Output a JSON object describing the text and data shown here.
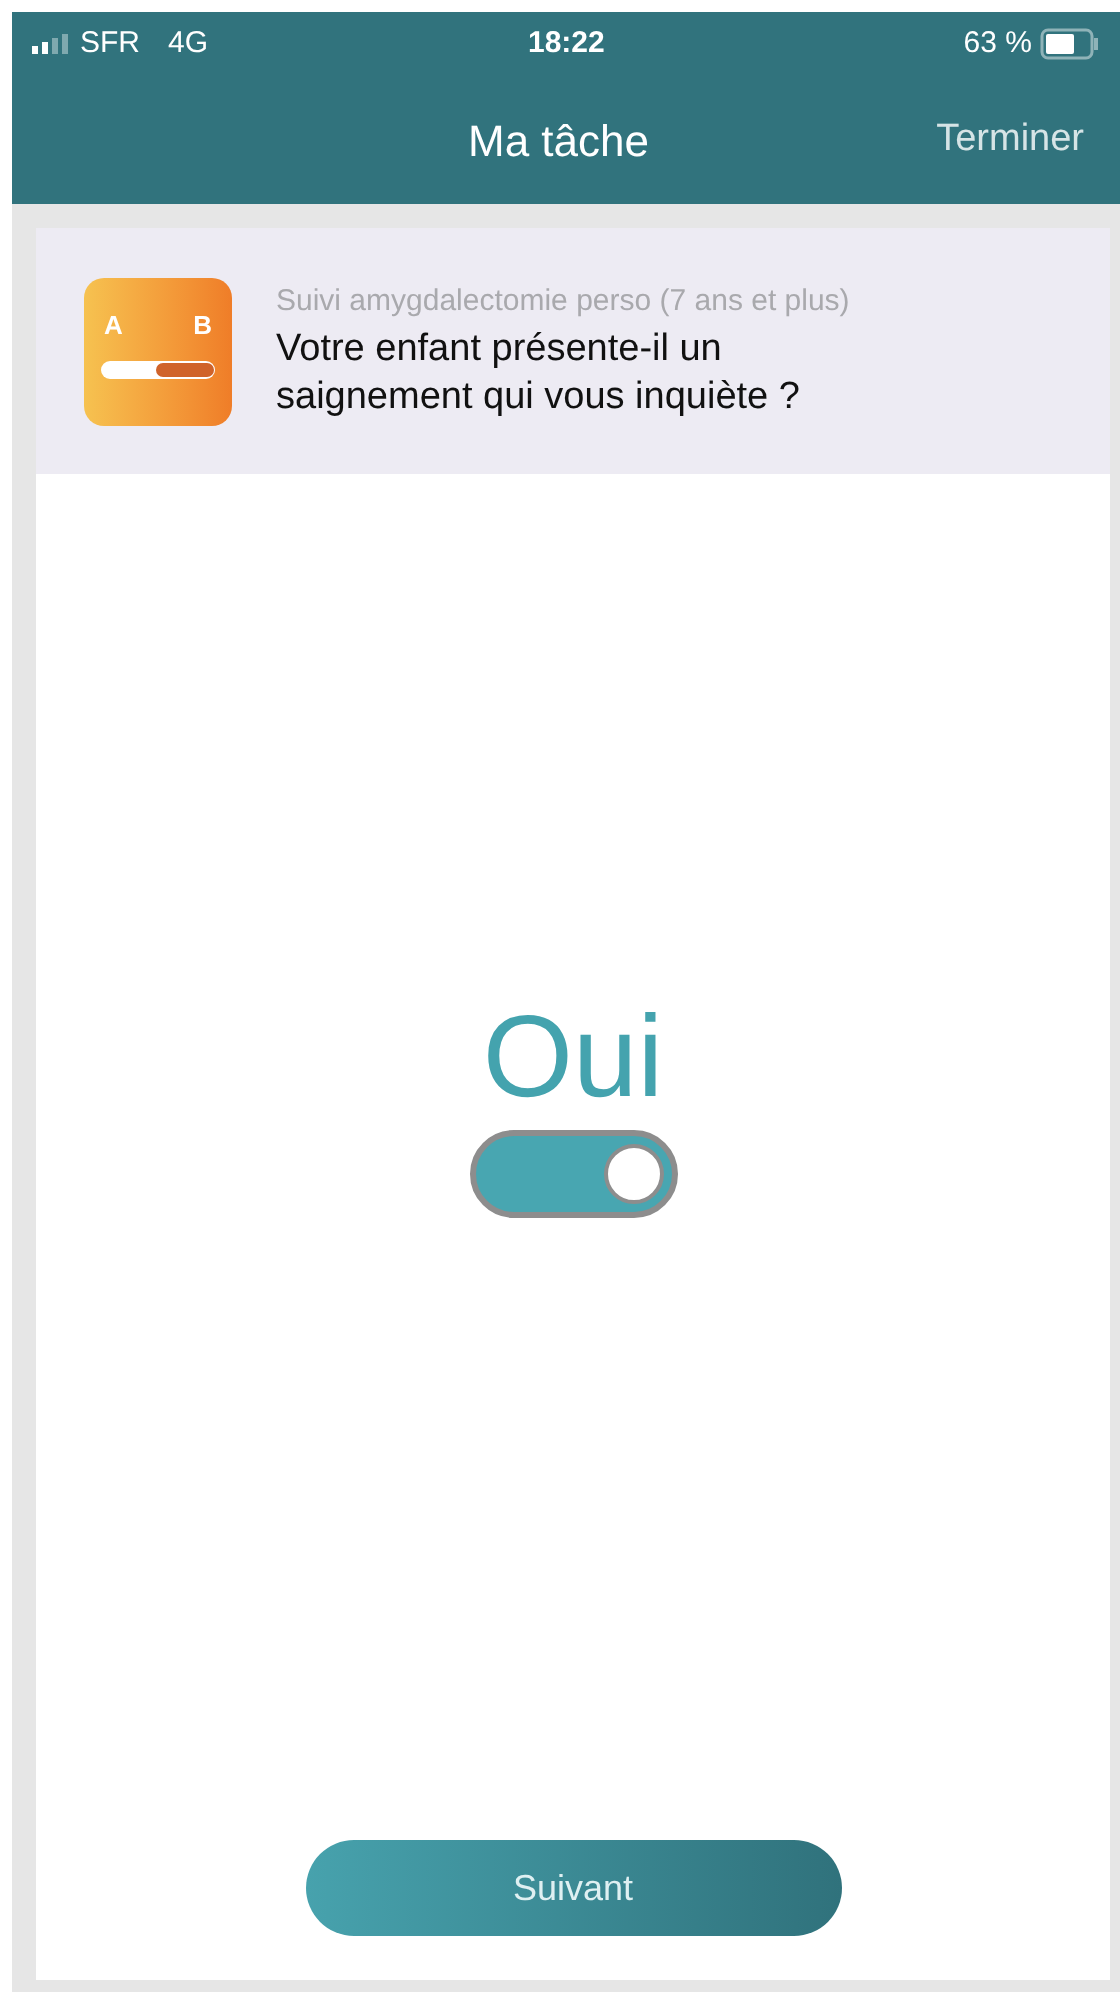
{
  "status_bar": {
    "carrier": "SFR",
    "network": "4G",
    "time": "18:22",
    "battery": "63 %"
  },
  "nav": {
    "title": "Ma tâche",
    "action": "Terminer"
  },
  "task": {
    "icon_labels": [
      "A",
      "B"
    ],
    "survey": "Suivi amygdalectomie perso (7 ans et plus)",
    "question": "Votre enfant présente-il un saignement qui vous inquiète ?"
  },
  "answer": {
    "label": "Oui",
    "on": true
  },
  "next_button": "Suivant"
}
